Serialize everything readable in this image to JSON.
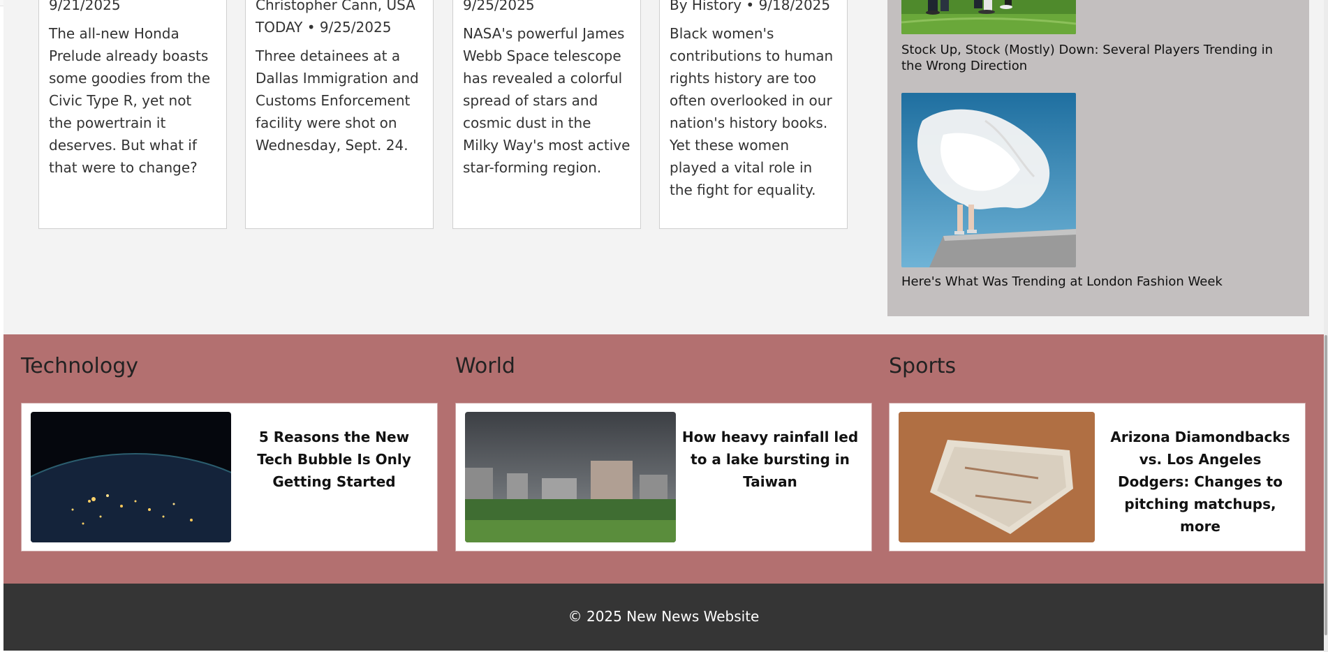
{
  "articles": [
    {
      "meta": "9/21/2025",
      "description": "The all-new Honda Prelude already boasts some goodies from the Civic Type R, yet not the powertrain it deserves. But what if that were to change?"
    },
    {
      "meta": "Christopher Cann, USA TODAY • 9/25/2025",
      "description": "Three detainees at a Dallas Immigration and Customs Enforcement facility were shot on Wednesday, Sept. 24."
    },
    {
      "meta": "9/25/2025",
      "description": "NASA's powerful James Webb Space telescope has revealed a colorful spread of stars and cosmic dust in the Milky Way's most active star-forming region."
    },
    {
      "meta": "By History • 9/18/2025",
      "description": "Black women's contributions to human rights history are too often overlooked in our nation's history books. Yet these women played a vital role in the fight for equality."
    }
  ],
  "trending": [
    {
      "title": "Stock Up, Stock (Mostly) Down: Several Players Trending in the Wrong Direction",
      "image": "soccer-players-on-grass"
    },
    {
      "title": "Here's What Was Trending at London Fashion Week",
      "image": "model-in-white-flowing-dress-against-sky"
    }
  ],
  "categories": [
    {
      "heading": "Technology",
      "story_title": "5 Reasons the New Tech Bubble Is Only Getting Started",
      "image": "earth-city-lights-from-space"
    },
    {
      "heading": "World",
      "story_title": "How heavy rainfall led to a lake bursting in Taiwan",
      "image": "stormy-sky-over-city-buildings"
    },
    {
      "heading": "Sports",
      "story_title": "Arizona Diamondbacks vs. Los Angeles Dodgers: Changes to pitching matchups, more",
      "image": "baseball-home-plate-in-dirt"
    }
  ],
  "footer": {
    "copyright": "© 2025 New News Website"
  },
  "colors": {
    "page_bg": "#f3f3f3",
    "trending_bg": "#c3bfbf",
    "categories_bg": "#b37070",
    "footer_bg": "#353535"
  }
}
